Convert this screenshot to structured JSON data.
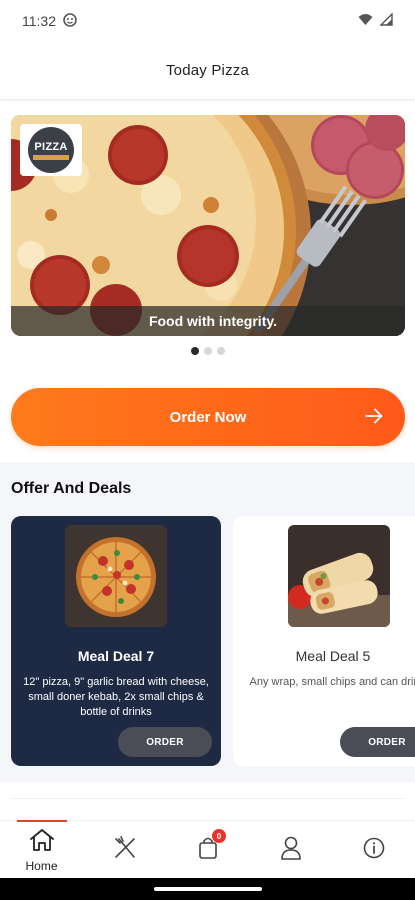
{
  "status_bar": {
    "time": "11:32",
    "icons": [
      "face-icon",
      "wifi-icon",
      "signal-icon"
    ]
  },
  "app_bar": {
    "title": "Today Pizza"
  },
  "banner": {
    "caption": "Food with integrity.",
    "logo_text": "PIZZA",
    "slide_count": 3,
    "active_slide": 1
  },
  "cta": {
    "order_now_label": "Order Now"
  },
  "offers": {
    "title": "Offer And Deals",
    "deals": [
      {
        "name": "Meal Deal 7",
        "description": "12\" pizza, 9\" garlic bread with cheese, small doner kebab, 2x small chips & bottle of drinks",
        "button": "ORDER"
      },
      {
        "name": "Meal Deal 5",
        "description": "Any wrap, small chips and can drinks",
        "button": "ORDER"
      }
    ]
  },
  "bottom_nav": {
    "items": [
      {
        "label": "Home",
        "icon": "home-icon",
        "active": true
      },
      {
        "label": "",
        "icon": "menu-utensils-icon",
        "active": false
      },
      {
        "label": "",
        "icon": "cart-bag-icon",
        "active": false,
        "badge": "0"
      },
      {
        "label": "",
        "icon": "profile-icon",
        "active": false
      },
      {
        "label": "",
        "icon": "info-icon",
        "active": false
      }
    ]
  },
  "colors": {
    "accent": "#ff6a1a",
    "dark_card": "#1e2a44",
    "nav_indicator": "#e8432b",
    "badge": "#e8322a"
  }
}
